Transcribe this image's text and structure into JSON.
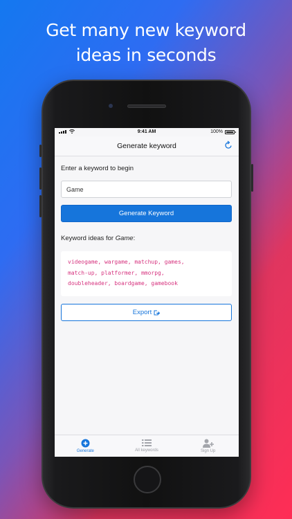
{
  "headline": {
    "line1": "Get many new keyword",
    "line2": "ideas in seconds"
  },
  "status_bar": {
    "time": "9:41 AM",
    "battery": "100%"
  },
  "navbar": {
    "title": "Generate keyword",
    "refresh_icon": "refresh-icon"
  },
  "form": {
    "prompt": "Enter a keyword to begin",
    "input_value": "Game",
    "generate_label": "Generate Keyword"
  },
  "results": {
    "label_prefix": "Keyword ideas for ",
    "keyword": "Game",
    "label_suffix": ":",
    "lines": [
      "videogame, wargame, matchup, games,",
      "match-up, platformer, mmorpg,",
      "doubleheader, boardgame, gamebook"
    ],
    "export_label": "Export",
    "export_icon": "external-link-icon"
  },
  "tabs": [
    {
      "label": "Generate",
      "icon": "plus-circle-icon",
      "active": true
    },
    {
      "label": "All keywords",
      "icon": "list-icon",
      "active": false
    },
    {
      "label": "Sign Up",
      "icon": "user-plus-icon",
      "active": false
    }
  ],
  "colors": {
    "accent": "#1675db",
    "code_text": "#d6327e",
    "gradient_start": "#1478f0",
    "gradient_end": "#ff2d55"
  }
}
